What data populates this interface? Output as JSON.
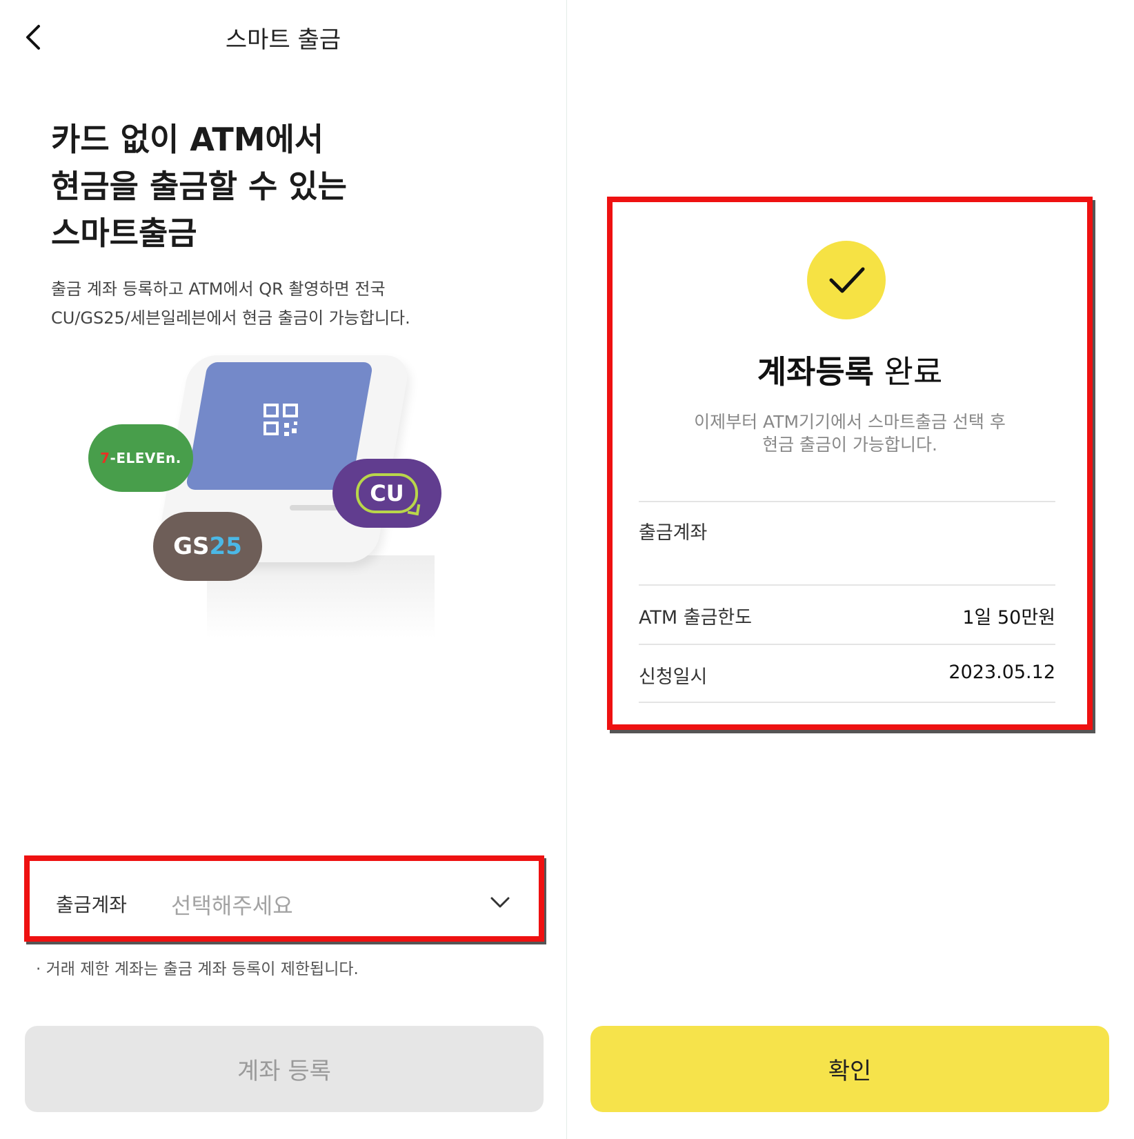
{
  "left": {
    "header": {
      "title": "스마트 출금",
      "back_icon": "chevron-left-icon"
    },
    "headline": [
      "카드 없이 ATM에서",
      "현금을 출금할 수 있는",
      "스마트출금"
    ],
    "description": [
      "출금 계좌 등록하고 ATM에서 QR 촬영하면 전국",
      "CU/GS25/세븐일레븐에서 현금 출금이 가능합니다."
    ],
    "illustration": {
      "badge_711": {
        "prefix": "7",
        "text": "-ELEVEn."
      },
      "badge_cu": "CU",
      "badge_gs": {
        "text": "GS",
        "number": "25"
      }
    },
    "account_field": {
      "label": "출금계좌",
      "placeholder": "선택해주세요",
      "icon": "chevron-down-icon"
    },
    "notice": "· 거래 제한 계좌는 출금 계좌 등록이 제한됩니다.",
    "register_button": "계좌 등록"
  },
  "right": {
    "check_icon": "checkmark-icon",
    "title_bold": "계좌등록",
    "title_rest": " 완료",
    "subtitle": [
      "이제부터 ATM기기에서 스마트출금 선택 후",
      "현금 출금이 가능합니다."
    ],
    "rows": [
      {
        "label": "출금계좌",
        "value": ""
      },
      {
        "label": "ATM 출금한도",
        "value": "1일 50만원"
      },
      {
        "label": "신청일시",
        "value": "2023.05.12"
      }
    ],
    "confirm_button": "확인"
  },
  "colors": {
    "accent_yellow": "#f6e34b",
    "highlight_red": "#ee1111",
    "disabled_gray": "#e6e6e6",
    "screen_blue": "#7489c9",
    "seven_eleven_green": "#489e4b",
    "cu_purple": "#613d8f",
    "gs25_brown": "#6e5e58"
  }
}
